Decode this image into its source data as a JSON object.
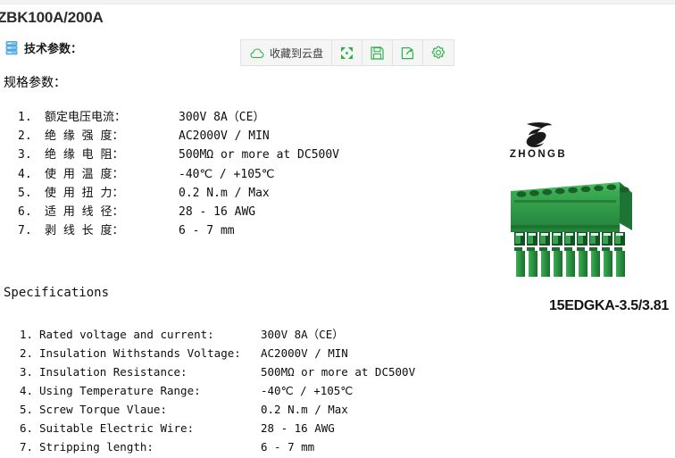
{
  "page_title": "ZBK100A/200A",
  "tech_section": {
    "icon": "database-icon",
    "label": "技术参数："
  },
  "toolbar": {
    "save_to_cloud_label": "收藏到云盘",
    "buttons": [
      {
        "icon": "cloud-icon",
        "name": "save-to-cloud-button"
      },
      {
        "icon": "fullscreen-icon",
        "name": "fullscreen-button"
      },
      {
        "icon": "save-icon",
        "name": "save-button"
      },
      {
        "icon": "share-icon",
        "name": "share-button"
      },
      {
        "icon": "gear-icon",
        "name": "settings-button"
      }
    ],
    "accent_color": "#2eb34a",
    "background_color": "#f5f5f5"
  },
  "spec_cn": {
    "heading": "规格参数：",
    "rows": [
      {
        "num": "1.",
        "label": "额定电压电流：",
        "value": "300V 8A（CE）"
      },
      {
        "num": "2.",
        "label": "绝 缘 强 度：",
        "value": "AC2000V / MIN"
      },
      {
        "num": "3.",
        "label": "绝 缘 电 阻：",
        "value": "500MΩ or more at DC500V"
      },
      {
        "num": "4.",
        "label": "使 用 温 度：",
        "value": "-40℃ / +105℃"
      },
      {
        "num": "5.",
        "label": "使 用 扭 力：",
        "value": "0.2 N.m / Max"
      },
      {
        "num": "6.",
        "label": "适 用 线 径：",
        "value": "28 - 16 AWG"
      },
      {
        "num": "7.",
        "label": "剥 线 长 度：",
        "value": "6 - 7 mm"
      }
    ]
  },
  "spec_en": {
    "heading": "Specifications",
    "rows": [
      {
        "num": "1.",
        "label": "Rated voltage and current:",
        "value": "300V 8A（CE）"
      },
      {
        "num": "2.",
        "label": "Insulation Withstands Voltage:",
        "value": "AC2000V / MIN"
      },
      {
        "num": "3.",
        "label": "Insulation Resistance:",
        "value": "500MΩ or more at DC500V"
      },
      {
        "num": "4.",
        "label": "Using Temperature Range:",
        "value": "-40℃ / +105℃"
      },
      {
        "num": "5.",
        "label": "Screw Torque Vlaue:",
        "value": "0.2 N.m / Max"
      },
      {
        "num": "6.",
        "label": "Suitable Electric Wire:",
        "value": "28 - 16 AWG"
      },
      {
        "num": "7.",
        "label": "Stripping length:",
        "value": "6 - 7 mm"
      }
    ]
  },
  "product": {
    "brand_name": "ZHONGB",
    "part_number": "15EDGKA-3.5/3.81",
    "pin_count": 9,
    "body_color": "#2f9d43"
  }
}
